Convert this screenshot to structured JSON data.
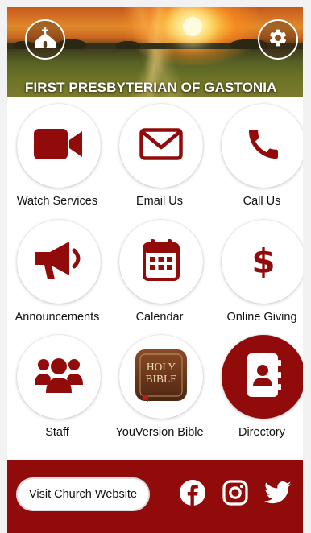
{
  "header": {
    "title": "FIRST PRESBYTERIAN OF GASTONIA",
    "left_icon": "church-icon",
    "right_icon": "gear-icon"
  },
  "grid": [
    {
      "label": "Watch Services",
      "icon": "video-camera-icon"
    },
    {
      "label": "Email Us",
      "icon": "envelope-icon"
    },
    {
      "label": "Call Us",
      "icon": "phone-icon"
    },
    {
      "label": "Announcements",
      "icon": "megaphone-icon"
    },
    {
      "label": "Calendar",
      "icon": "calendar-icon"
    },
    {
      "label": "Online Giving",
      "icon": "dollar-icon"
    },
    {
      "label": "Staff",
      "icon": "people-icon"
    },
    {
      "label": "YouVersion Bible",
      "icon": "holy-bible-icon",
      "icon_text": [
        "HOLY",
        "BIBLE"
      ]
    },
    {
      "label": "Directory",
      "icon": "address-book-icon",
      "highlighted": true
    }
  ],
  "footer": {
    "visit_label": "Visit Church Website",
    "social": [
      "facebook-icon",
      "instagram-icon",
      "twitter-icon"
    ]
  },
  "colors": {
    "accent": "#920b0b",
    "background": "#ffffff",
    "text": "#111111"
  }
}
